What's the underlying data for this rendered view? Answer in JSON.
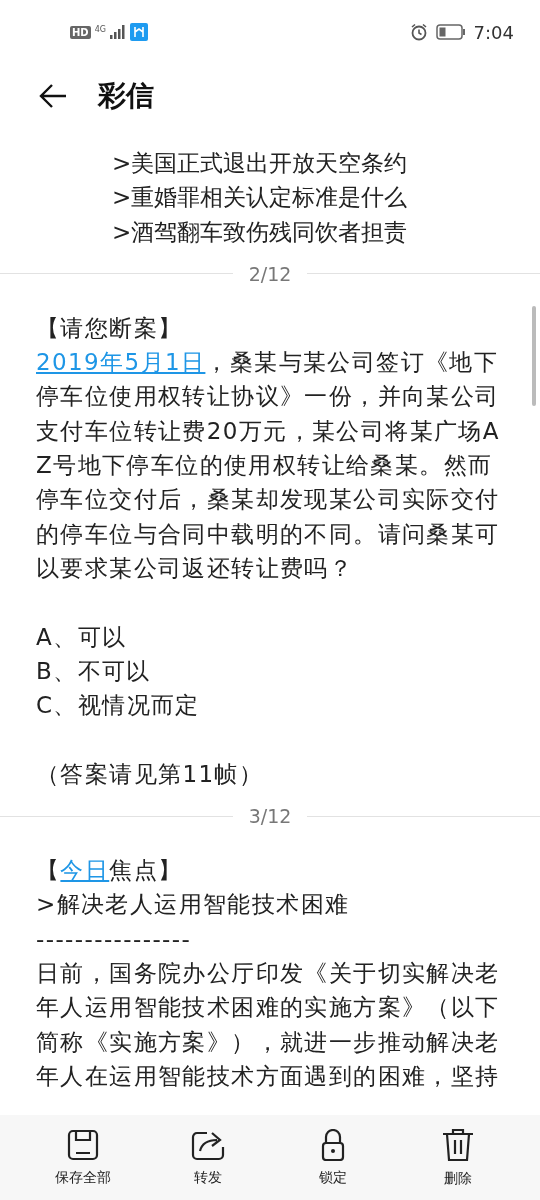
{
  "status_bar": {
    "left": [
      "HD",
      "4G"
    ],
    "time": "7:04"
  },
  "header": {
    "title": "彩信"
  },
  "slides": [
    {
      "lines": [
        {
          "parts": [
            {
              "text": ">美国正式退出开放天空条约"
            }
          ]
        },
        {
          "parts": [
            {
              "text": ">重婚罪相关认定标准是什么"
            }
          ]
        },
        {
          "parts": [
            {
              "text": ">酒驾翻车致伤残同饮者担责"
            }
          ]
        }
      ],
      "indent": true
    },
    {
      "page": "2/12",
      "lines": [
        {
          "parts": [
            {
              "text": "【请您断案】"
            }
          ]
        },
        {
          "parts": [
            {
              "text": "2019年5月1日",
              "link": true
            },
            {
              "text": "，桑某与某公司签订《地下停车位使用权转让协议》一份，并向某公司支付车位转让费20万元，某公司将某广场AZ号地下停车位的使用权转让给桑某。然而停车位交付后，桑某却发现某公司实际交付的停车位与合同中载明的不同。请问桑某可以要求某公司返还转让费吗？"
            }
          ]
        },
        {
          "kind": "blank"
        },
        {
          "parts": [
            {
              "text": "A、可以"
            }
          ]
        },
        {
          "parts": [
            {
              "text": "B、不可以"
            }
          ]
        },
        {
          "parts": [
            {
              "text": "C、视情况而定"
            }
          ]
        },
        {
          "kind": "blank"
        },
        {
          "parts": [
            {
              "text": "（答案请见第11帧）"
            }
          ]
        }
      ]
    },
    {
      "page": "3/12",
      "lines": [
        {
          "parts": [
            {
              "text": "【"
            },
            {
              "text": "今日",
              "link": true
            },
            {
              "text": "焦点】"
            }
          ]
        },
        {
          "parts": [
            {
              "text": ">解决老人运用智能技术困难"
            }
          ]
        },
        {
          "parts": [
            {
              "text": "----------------"
            }
          ]
        },
        {
          "parts": [
            {
              "text": "日前，国务院办公厅印发《关于切实解决老年人运用智能技术困难的实施方案》（以下简称《实施方案》），就进一步推动解决老年人在运用智能技术方面遇到的困难，坚持"
            }
          ]
        }
      ]
    }
  ],
  "toolbar": [
    {
      "kind": "save",
      "label": "保存全部"
    },
    {
      "kind": "forward",
      "label": "转发"
    },
    {
      "kind": "lock",
      "label": "锁定"
    },
    {
      "kind": "delete",
      "label": "删除"
    }
  ]
}
